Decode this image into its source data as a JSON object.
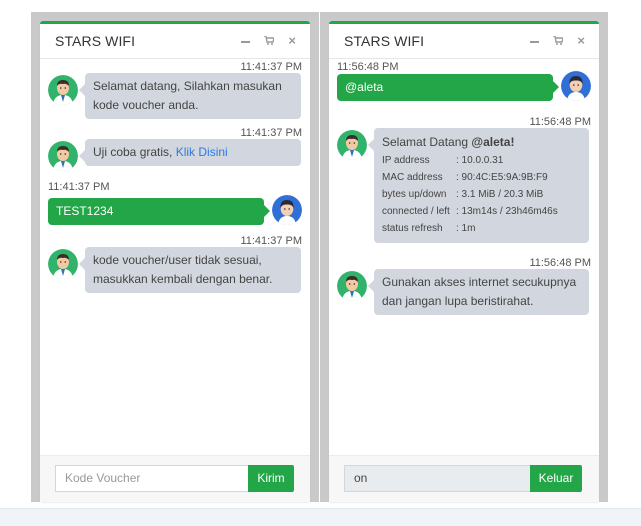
{
  "colors": {
    "accent": "#22a647",
    "bubble": "#d2d6de",
    "link": "#2c7be5"
  },
  "icons": {
    "minimize": "minus-icon",
    "cart": "cart-icon",
    "close": "close-icon",
    "avatar_server": "server-avatar-icon",
    "avatar_user": "user-avatar-icon"
  },
  "left_panel": {
    "title": "STARS WIFI",
    "messages": [
      {
        "time": "11:41:37 PM",
        "text": "Selamat datang, Silahkan masukan kode voucher anda."
      },
      {
        "time": "11:41:37 PM",
        "text": "Uji coba gratis, ",
        "link": "Klik Disini"
      },
      {
        "time": "11:41:37 PM",
        "text": "TEST1234"
      },
      {
        "time": "11:41:37 PM",
        "text": "kode voucher/user tidak sesuai, masukkan kembali dengan benar."
      }
    ],
    "input_placeholder": "Kode Voucher",
    "button": "Kirim"
  },
  "right_panel": {
    "title": "STARS WIFI",
    "messages": [
      {
        "time": "11:56:48 PM",
        "text": "@aleta"
      },
      {
        "time": "11:56:48 PM",
        "greeting": "Selamat Datang ",
        "user": "@aleta!",
        "info": [
          {
            "k": "IP address",
            "v": ": 10.0.0.31"
          },
          {
            "k": "MAC address",
            "v": ": 90:4C:E5:9A:9B:F9"
          },
          {
            "k": "bytes up/down",
            "v": ": 3.1 MiB / 20.3 MiB"
          },
          {
            "k": "connected / left",
            "v": ": 13m14s / 23h46m46s"
          },
          {
            "k": "status refresh",
            "v": ": 1m"
          }
        ]
      },
      {
        "time": "11:56:48 PM",
        "text": "Gunakan akses internet secukupnya dan jangan lupa beristirahat."
      }
    ],
    "input_value": "on",
    "button": "Keluar"
  }
}
